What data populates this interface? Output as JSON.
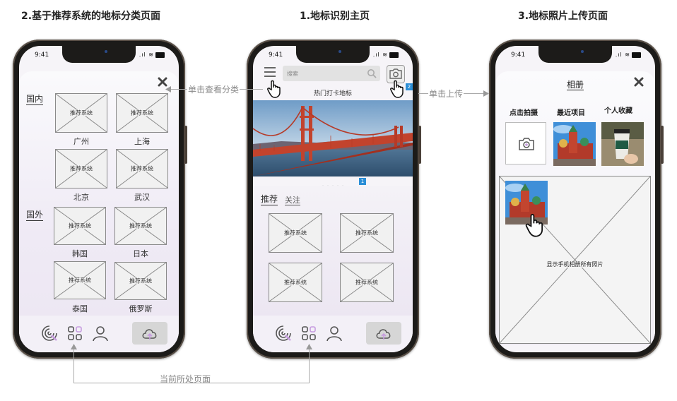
{
  "titles": {
    "left": "2.基于推荐系统的地标分类页面",
    "middle": "1.地标识别主页",
    "right": "3.地标照片上传页面"
  },
  "status_bar": {
    "time": "9:41"
  },
  "placeholder_label": "推荐系统",
  "category_page": {
    "domestic_label": "国内",
    "foreign_label": "国外",
    "domestic": [
      "广州",
      "上海",
      "北京",
      "武汉"
    ],
    "foreign": [
      "韩国",
      "日本",
      "泰国",
      "俄罗斯"
    ]
  },
  "home_page": {
    "search_placeholder": "搜索",
    "hot_label": "热门打卡地标",
    "carousel_badge": "1",
    "camera_badge": "2",
    "tabs": [
      "推荐",
      "关注"
    ]
  },
  "upload_page": {
    "title": "相册",
    "tabs": [
      "点击拍摄",
      "最近项目",
      "个人收藏"
    ],
    "album_caption": "显示手机相册所有照片"
  },
  "annotations": {
    "tap_categories": "单击查看分类",
    "tap_upload": "单击上传",
    "current_page": "当前所处页面"
  },
  "icons": {
    "close": "close-icon",
    "menu": "hamburger-menu-icon",
    "camera": "camera-icon",
    "search": "search-icon",
    "hand": "hand-pointer-icon",
    "scan": "scan-icon",
    "grid": "grid-icon",
    "user": "user-icon",
    "cloud": "cloud-upload-icon"
  },
  "colors": {
    "accent": "#c79ce0",
    "badge": "#2b8ed6"
  }
}
